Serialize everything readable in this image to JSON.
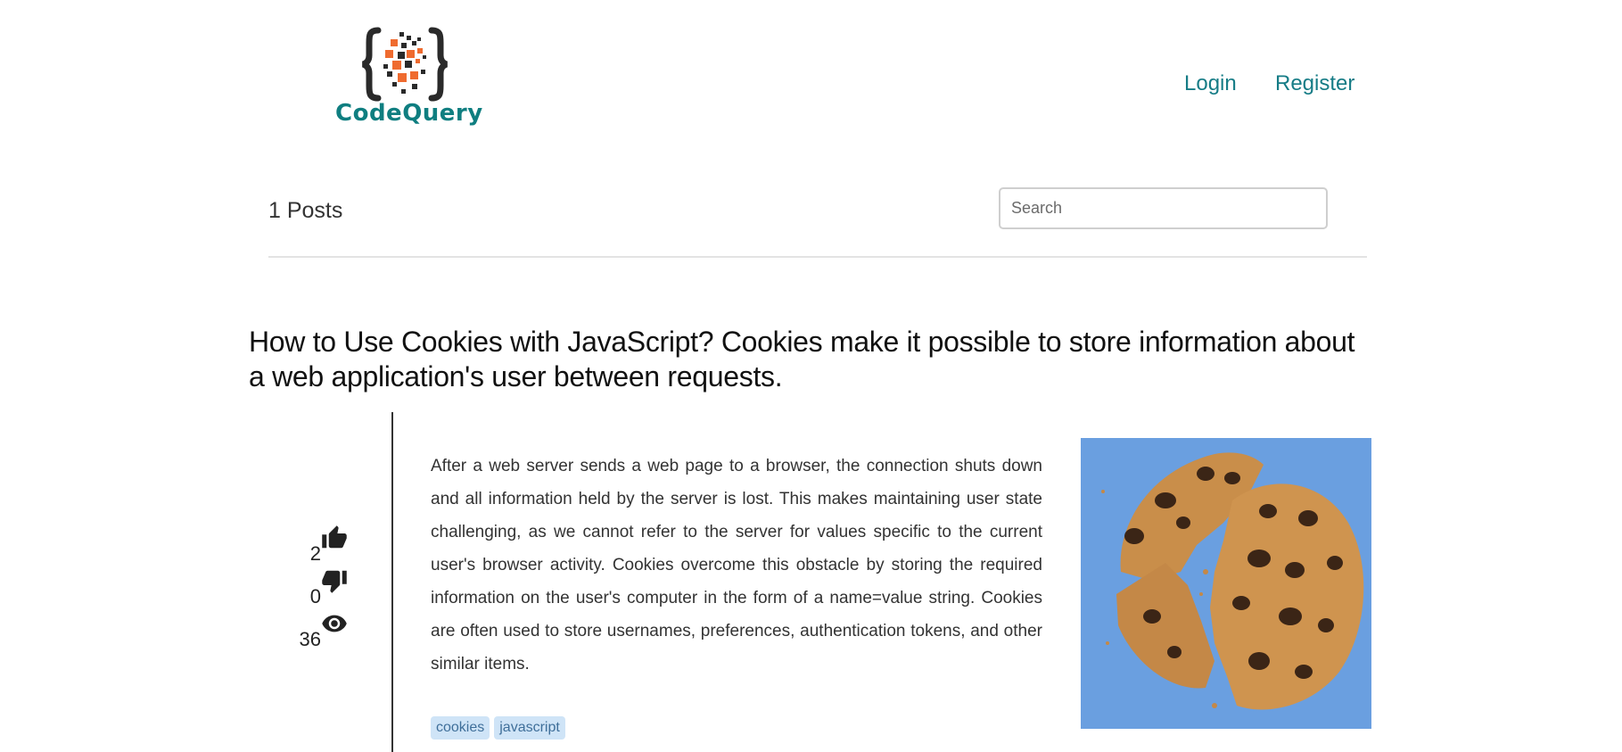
{
  "header": {
    "logo_text": "CodeQuery",
    "nav": {
      "login": "Login",
      "register": "Register"
    }
  },
  "toolbar": {
    "posts_count": "1 Posts",
    "search_placeholder": "Search"
  },
  "post": {
    "title": "How to Use Cookies with JavaScript? Cookies make it possible to store information about a web application's user between requests.",
    "likes": "2",
    "dislikes": "0",
    "views": "36",
    "body": "After a web server sends a web page to a browser, the connection shuts down and all information held by the server is lost. This makes maintaining user state challenging, as we cannot refer to the server for values specific to the current user's browser activity. Cookies overcome this obstacle by storing the required information on the user's computer in the form of a name=value string. Cookies are often used to store usernames, preferences, authentication tokens, and other similar items.",
    "tags": [
      "cookies",
      "javascript"
    ]
  },
  "icons": {
    "likes": "thumbs-up-icon",
    "dislikes": "thumbs-down-icon",
    "views": "eye-icon"
  },
  "colors": {
    "brand": "#0f7e80",
    "link": "#167c86",
    "logo_orange": "#ef6b2f",
    "image_background": "#6a9fe0",
    "tag_background": "#cfe4f7"
  }
}
